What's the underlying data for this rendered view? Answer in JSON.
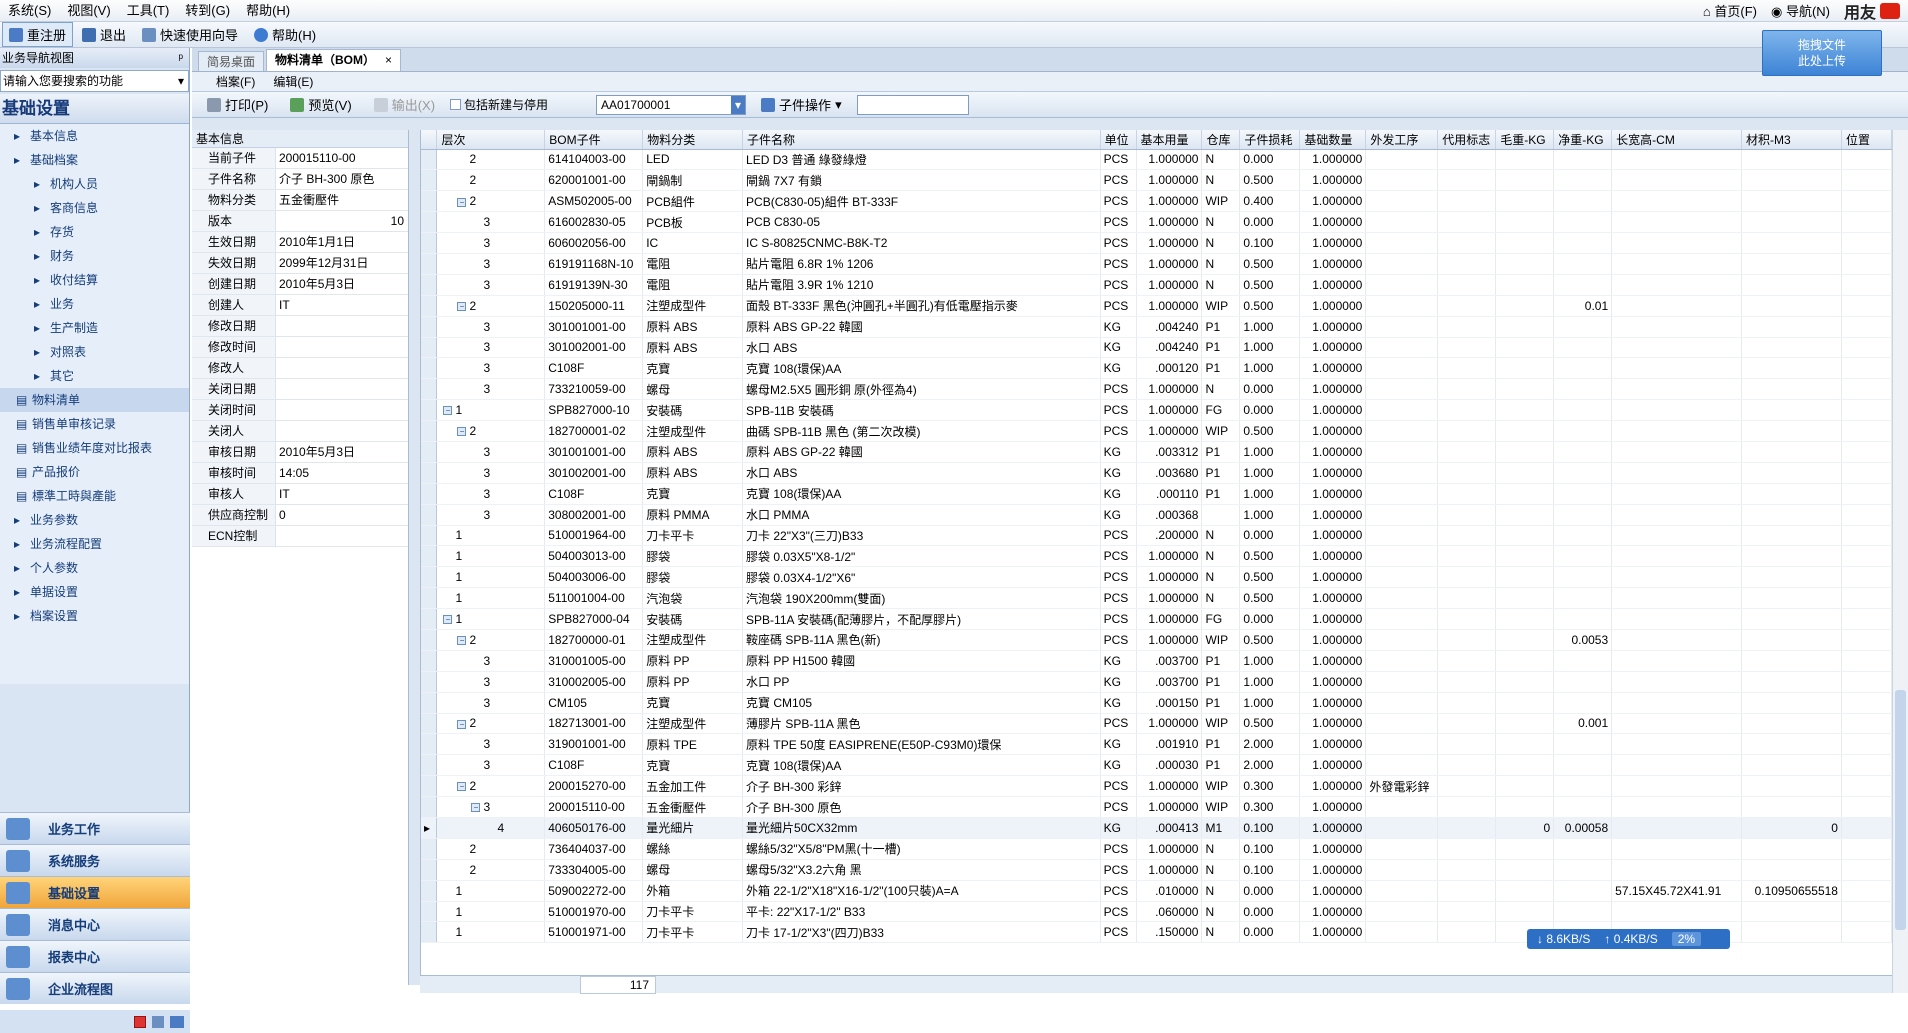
{
  "menubar": {
    "items": [
      "系统(S)",
      "视图(V)",
      "工具(T)",
      "转到(G)",
      "帮助(H)"
    ],
    "home": "首页(F)",
    "nav": "导航(N)",
    "brand": "用友"
  },
  "toolbar": {
    "items": [
      "重注册",
      "退出",
      "快速使用向导",
      "帮助(H)"
    ]
  },
  "sidebar": {
    "header": "业务导航视图",
    "search_placeholder": "请输入您要搜索的功能",
    "title": "基础设置",
    "tree": [
      {
        "label": "基本信息",
        "level": 1
      },
      {
        "label": "基础档案",
        "level": 1
      },
      {
        "label": "机构人员",
        "level": 2
      },
      {
        "label": "客商信息",
        "level": 2
      },
      {
        "label": "存货",
        "level": 2
      },
      {
        "label": "财务",
        "level": 2
      },
      {
        "label": "收付结算",
        "level": 2
      },
      {
        "label": "业务",
        "level": 2
      },
      {
        "label": "生产制造",
        "level": 2
      },
      {
        "label": "对照表",
        "level": 2
      },
      {
        "label": "其它",
        "level": 2
      },
      {
        "label": "物料清单",
        "level": 3,
        "selected": true
      },
      {
        "label": "销售单审核记录",
        "level": 3
      },
      {
        "label": "销售业绩年度对比报表",
        "level": 3
      },
      {
        "label": "产品报价",
        "level": 3
      },
      {
        "label": "標準工時與產能",
        "level": 3
      },
      {
        "label": "业务参数",
        "level": 1
      },
      {
        "label": "业务流程配置",
        "level": 1
      },
      {
        "label": "个人参数",
        "level": 1
      },
      {
        "label": "单据设置",
        "level": 1
      },
      {
        "label": "档案设置",
        "level": 1
      }
    ],
    "modules": [
      {
        "label": "业务工作"
      },
      {
        "label": "系统服务"
      },
      {
        "label": "基础设置",
        "selected": true
      },
      {
        "label": "消息中心"
      },
      {
        "label": "报表中心"
      },
      {
        "label": "企业流程图"
      }
    ]
  },
  "tabs": [
    {
      "label": "简易桌面"
    },
    {
      "label": "物料清单（BOM）",
      "active": true,
      "close": "×"
    }
  ],
  "upload_button": [
    "拖拽文件",
    "此处上传"
  ],
  "submenu": [
    "档案(F)",
    "编辑(E)"
  ],
  "opbar": {
    "print": "打印(P)",
    "preview": "预览(V)",
    "output": "输出(X)",
    "include_label": "包括新建与停用",
    "code": "AA01700001",
    "child_ops": "子件操作"
  },
  "info_panel": {
    "title": "基本信息",
    "rows": [
      {
        "k": "当前子件",
        "v": "200015110-00"
      },
      {
        "k": "子件名称",
        "v": "介子 BH-300 原色"
      },
      {
        "k": "物料分类",
        "v": "五金衝壓件"
      },
      {
        "k": "版本",
        "v": "10",
        "right": true
      },
      {
        "k": "生效日期",
        "v": "2010年1月1日"
      },
      {
        "k": "失效日期",
        "v": "2099年12月31日"
      },
      {
        "k": "创建日期",
        "v": "2010年5月3日"
      },
      {
        "k": "创建人",
        "v": "IT"
      },
      {
        "k": "修改日期",
        "v": ""
      },
      {
        "k": "修改时间",
        "v": ""
      },
      {
        "k": "修改人",
        "v": ""
      },
      {
        "k": "关闭日期",
        "v": ""
      },
      {
        "k": "关闭时间",
        "v": ""
      },
      {
        "k": "关闭人",
        "v": ""
      },
      {
        "k": "审核日期",
        "v": "2010年5月3日"
      },
      {
        "k": "审核时间",
        "v": "14:05"
      },
      {
        "k": "审核人",
        "v": "IT"
      },
      {
        "k": "供应商控制",
        "v": "0"
      },
      {
        "k": "ECN控制",
        "v": ""
      }
    ]
  },
  "grid": {
    "columns": [
      "层次",
      "BOM子件",
      "物料分类",
      "子件名称",
      "单位",
      "基本用量",
      "仓库",
      "子件损耗",
      "基础数量",
      "外发工序",
      "代用标志",
      "毛重-KG",
      "净重-KG",
      "长宽高-CM",
      "材积-M3",
      "位置"
    ],
    "rows": [
      {
        "lv": "2",
        "exp": false,
        "code": "614104003-00",
        "cls": "LED",
        "name": "LED D3 普通 綠發綠燈",
        "unit": "PCS",
        "qty": "1.000000",
        "wh": "N",
        "loss": "0.000",
        "base": "1.000000"
      },
      {
        "lv": "2",
        "exp": false,
        "code": "620001001-00",
        "cls": "閘鍋制",
        "name": "閘鍋 7X7 有鎖",
        "unit": "PCS",
        "qty": "1.000000",
        "wh": "N",
        "loss": "0.500",
        "base": "1.000000"
      },
      {
        "lv": "2",
        "exp": true,
        "code": "ASM502005-00",
        "cls": "PCB組件",
        "name": "PCB(C830-05)組件 BT-333F",
        "unit": "PCS",
        "qty": "1.000000",
        "wh": "WIP",
        "loss": "0.400",
        "base": "1.000000"
      },
      {
        "lv": "3",
        "exp": false,
        "code": "616002830-05",
        "cls": "PCB板",
        "name": "PCB C830-05",
        "unit": "PCS",
        "qty": "1.000000",
        "wh": "N",
        "loss": "0.000",
        "base": "1.000000"
      },
      {
        "lv": "3",
        "exp": false,
        "code": "606002056-00",
        "cls": "IC",
        "name": "IC S-80825CNMC-B8K-T2",
        "unit": "PCS",
        "qty": "1.000000",
        "wh": "N",
        "loss": "0.100",
        "base": "1.000000"
      },
      {
        "lv": "3",
        "exp": false,
        "code": "619191168N-10",
        "cls": "電阻",
        "name": "貼片電阻 6.8R 1% 1206",
        "unit": "PCS",
        "qty": "1.000000",
        "wh": "N",
        "loss": "0.500",
        "base": "1.000000"
      },
      {
        "lv": "3",
        "exp": false,
        "code": "61919139N-30",
        "cls": "電阻",
        "name": "貼片電阻 3.9R 1% 1210",
        "unit": "PCS",
        "qty": "1.000000",
        "wh": "N",
        "loss": "0.500",
        "base": "1.000000"
      },
      {
        "lv": "2",
        "exp": true,
        "code": "150205000-11",
        "cls": "注塑成型件",
        "name": "面殼 BT-333F 黑色(沖圓孔+半圓孔)有低電壓指示麥",
        "unit": "PCS",
        "qty": "1.000000",
        "wh": "WIP",
        "loss": "0.500",
        "base": "1.000000",
        "net": "0.01"
      },
      {
        "lv": "3",
        "exp": false,
        "code": "301001001-00",
        "cls": "原料 ABS",
        "name": "原料 ABS GP-22 韓國",
        "unit": "KG",
        "qty": ".004240",
        "wh": "P1",
        "loss": "1.000",
        "base": "1.000000"
      },
      {
        "lv": "3",
        "exp": false,
        "code": "301002001-00",
        "cls": "原料 ABS",
        "name": "水口 ABS",
        "unit": "KG",
        "qty": ".004240",
        "wh": "P1",
        "loss": "1.000",
        "base": "1.000000"
      },
      {
        "lv": "3",
        "exp": false,
        "code": "C108F",
        "cls": "克寶",
        "name": "克寶 108(環保)AA",
        "unit": "KG",
        "qty": ".000120",
        "wh": "P1",
        "loss": "1.000",
        "base": "1.000000"
      },
      {
        "lv": "3",
        "exp": false,
        "code": "733210059-00",
        "cls": "螺母",
        "name": "螺母M2.5X5 圓形銅 原(外徑為4)",
        "unit": "PCS",
        "qty": "1.000000",
        "wh": "N",
        "loss": "0.000",
        "base": "1.000000"
      },
      {
        "lv": "1",
        "exp": true,
        "code": "SPB827000-10",
        "cls": "安裝碼",
        "name": "SPB-11B 安裝碼",
        "unit": "PCS",
        "qty": "1.000000",
        "wh": "FG",
        "loss": "0.000",
        "base": "1.000000"
      },
      {
        "lv": "2",
        "exp": true,
        "code": "182700001-02",
        "cls": "注塑成型件",
        "name": "曲碼 SPB-11B 黑色 (第二次改模)",
        "unit": "PCS",
        "qty": "1.000000",
        "wh": "WIP",
        "loss": "0.500",
        "base": "1.000000"
      },
      {
        "lv": "3",
        "exp": false,
        "code": "301001001-00",
        "cls": "原料 ABS",
        "name": "原料 ABS GP-22 韓國",
        "unit": "KG",
        "qty": ".003312",
        "wh": "P1",
        "loss": "1.000",
        "base": "1.000000"
      },
      {
        "lv": "3",
        "exp": false,
        "code": "301002001-00",
        "cls": "原料 ABS",
        "name": "水口 ABS",
        "unit": "KG",
        "qty": ".003680",
        "wh": "P1",
        "loss": "1.000",
        "base": "1.000000"
      },
      {
        "lv": "3",
        "exp": false,
        "code": "C108F",
        "cls": "克寶",
        "name": "克寶 108(環保)AA",
        "unit": "KG",
        "qty": ".000110",
        "wh": "P1",
        "loss": "1.000",
        "base": "1.000000"
      },
      {
        "lv": "3",
        "exp": false,
        "code": "308002001-00",
        "cls": "原料 PMMA",
        "name": "水口 PMMA",
        "unit": "KG",
        "qty": ".000368",
        "wh": "",
        "loss": "1.000",
        "base": "1.000000"
      },
      {
        "lv": "1",
        "exp": false,
        "code": "510001964-00",
        "cls": "刀卡平卡",
        "name": "刀卡 22\"X3\"(三刀)B33",
        "unit": "PCS",
        "qty": ".200000",
        "wh": "N",
        "loss": "0.000",
        "base": "1.000000"
      },
      {
        "lv": "1",
        "exp": false,
        "code": "504003013-00",
        "cls": "膠袋",
        "name": "膠袋 0.03X5\"X8-1/2\"",
        "unit": "PCS",
        "qty": "1.000000",
        "wh": "N",
        "loss": "0.500",
        "base": "1.000000"
      },
      {
        "lv": "1",
        "exp": false,
        "code": "504003006-00",
        "cls": "膠袋",
        "name": "膠袋 0.03X4-1/2\"X6\"",
        "unit": "PCS",
        "qty": "1.000000",
        "wh": "N",
        "loss": "0.500",
        "base": "1.000000"
      },
      {
        "lv": "1",
        "exp": false,
        "code": "511001004-00",
        "cls": "汽泡袋",
        "name": "汽泡袋 190X200mm(雙面)",
        "unit": "PCS",
        "qty": "1.000000",
        "wh": "N",
        "loss": "0.500",
        "base": "1.000000"
      },
      {
        "lv": "1",
        "exp": true,
        "code": "SPB827000-04",
        "cls": "安裝碼",
        "name": "SPB-11A 安裝碼(配薄膠片，不配厚膠片)",
        "unit": "PCS",
        "qty": "1.000000",
        "wh": "FG",
        "loss": "0.000",
        "base": "1.000000"
      },
      {
        "lv": "2",
        "exp": true,
        "code": "182700000-01",
        "cls": "注塑成型件",
        "name": "鞍座碼 SPB-11A 黑色(新)",
        "unit": "PCS",
        "qty": "1.000000",
        "wh": "WIP",
        "loss": "0.500",
        "base": "1.000000",
        "net": "0.0053"
      },
      {
        "lv": "3",
        "exp": false,
        "code": "310001005-00",
        "cls": "原料 PP",
        "name": "原料 PP H1500 韓國",
        "unit": "KG",
        "qty": ".003700",
        "wh": "P1",
        "loss": "1.000",
        "base": "1.000000"
      },
      {
        "lv": "3",
        "exp": false,
        "code": "310002005-00",
        "cls": "原料 PP",
        "name": "水口 PP",
        "unit": "KG",
        "qty": ".003700",
        "wh": "P1",
        "loss": "1.000",
        "base": "1.000000"
      },
      {
        "lv": "3",
        "exp": false,
        "code": "CM105",
        "cls": "克寶",
        "name": "克寶 CM105",
        "unit": "KG",
        "qty": ".000150",
        "wh": "P1",
        "loss": "1.000",
        "base": "1.000000"
      },
      {
        "lv": "2",
        "exp": true,
        "code": "182713001-00",
        "cls": "注塑成型件",
        "name": "薄膠片 SPB-11A 黑色",
        "unit": "PCS",
        "qty": "1.000000",
        "wh": "WIP",
        "loss": "0.500",
        "base": "1.000000",
        "net": "0.001"
      },
      {
        "lv": "3",
        "exp": false,
        "code": "319001001-00",
        "cls": "原料 TPE",
        "name": "原料 TPE 50度 EASIPRENE(E50P-C93M0)環保",
        "unit": "KG",
        "qty": ".001910",
        "wh": "P1",
        "loss": "2.000",
        "base": "1.000000"
      },
      {
        "lv": "3",
        "exp": false,
        "code": "C108F",
        "cls": "克寶",
        "name": "克寶 108(環保)AA",
        "unit": "KG",
        "qty": ".000030",
        "wh": "P1",
        "loss": "2.000",
        "base": "1.000000"
      },
      {
        "lv": "2",
        "exp": true,
        "code": "200015270-00",
        "cls": "五金加工件",
        "name": "介子 BH-300 彩鋅",
        "unit": "PCS",
        "qty": "1.000000",
        "wh": "WIP",
        "loss": "0.300",
        "base": "1.000000",
        "ext": "外發電彩鋅"
      },
      {
        "lv": "3",
        "exp": true,
        "code": "200015110-00",
        "cls": "五金衝壓件",
        "name": "介子 BH-300 原色",
        "unit": "PCS",
        "qty": "1.000000",
        "wh": "WIP",
        "loss": "0.300",
        "base": "1.000000"
      },
      {
        "lv": "4",
        "exp": false,
        "cur": true,
        "code": "406050176-00",
        "cls": "量光細片",
        "name": "量光細片50CX32mm",
        "unit": "KG",
        "qty": ".000413",
        "wh": "M1",
        "loss": "0.100",
        "base": "1.000000",
        "gross": "0",
        "net": "0.00058",
        "vol": "0"
      },
      {
        "lv": "2",
        "exp": false,
        "code": "736404037-00",
        "cls": "螺絲",
        "name": "螺絲5/32\"X5/8\"PM黑(十一槽)",
        "unit": "PCS",
        "qty": "1.000000",
        "wh": "N",
        "loss": "0.100",
        "base": "1.000000"
      },
      {
        "lv": "2",
        "exp": false,
        "code": "733304005-00",
        "cls": "螺母",
        "name": "螺母5/32\"X3.2六角 黑",
        "unit": "PCS",
        "qty": "1.000000",
        "wh": "N",
        "loss": "0.100",
        "base": "1.000000"
      },
      {
        "lv": "1",
        "exp": false,
        "code": "509002272-00",
        "cls": "外箱",
        "name": "外箱 22-1/2\"X18\"X16-1/2\"(100只裝)A=A",
        "unit": "PCS",
        "qty": ".010000",
        "wh": "N",
        "loss": "0.000",
        "base": "1.000000",
        "dim": "57.15X45.72X41.91",
        "vol": "0.10950655518"
      },
      {
        "lv": "1",
        "exp": false,
        "code": "510001970-00",
        "cls": "刀卡平卡",
        "name": "平卡: 22\"X17-1/2\" B33",
        "unit": "PCS",
        "qty": ".060000",
        "wh": "N",
        "loss": "0.000",
        "base": "1.000000"
      },
      {
        "lv": "1",
        "exp": false,
        "code": "510001971-00",
        "cls": "刀卡平卡",
        "name": "刀卡 17-1/2\"X3\"(四刀)B33",
        "unit": "PCS",
        "qty": ".150000",
        "wh": "N",
        "loss": "0.000",
        "base": "1.000000"
      }
    ],
    "total": "117"
  },
  "net_monitor": {
    "down": "8.6KB/S",
    "up": "0.4KB/S",
    "pct": "2%"
  },
  "colors": {
    "accent": "#2e6fc6",
    "sidebar_bg": "#d9e5f3",
    "selected_module": "#f0a53a"
  }
}
